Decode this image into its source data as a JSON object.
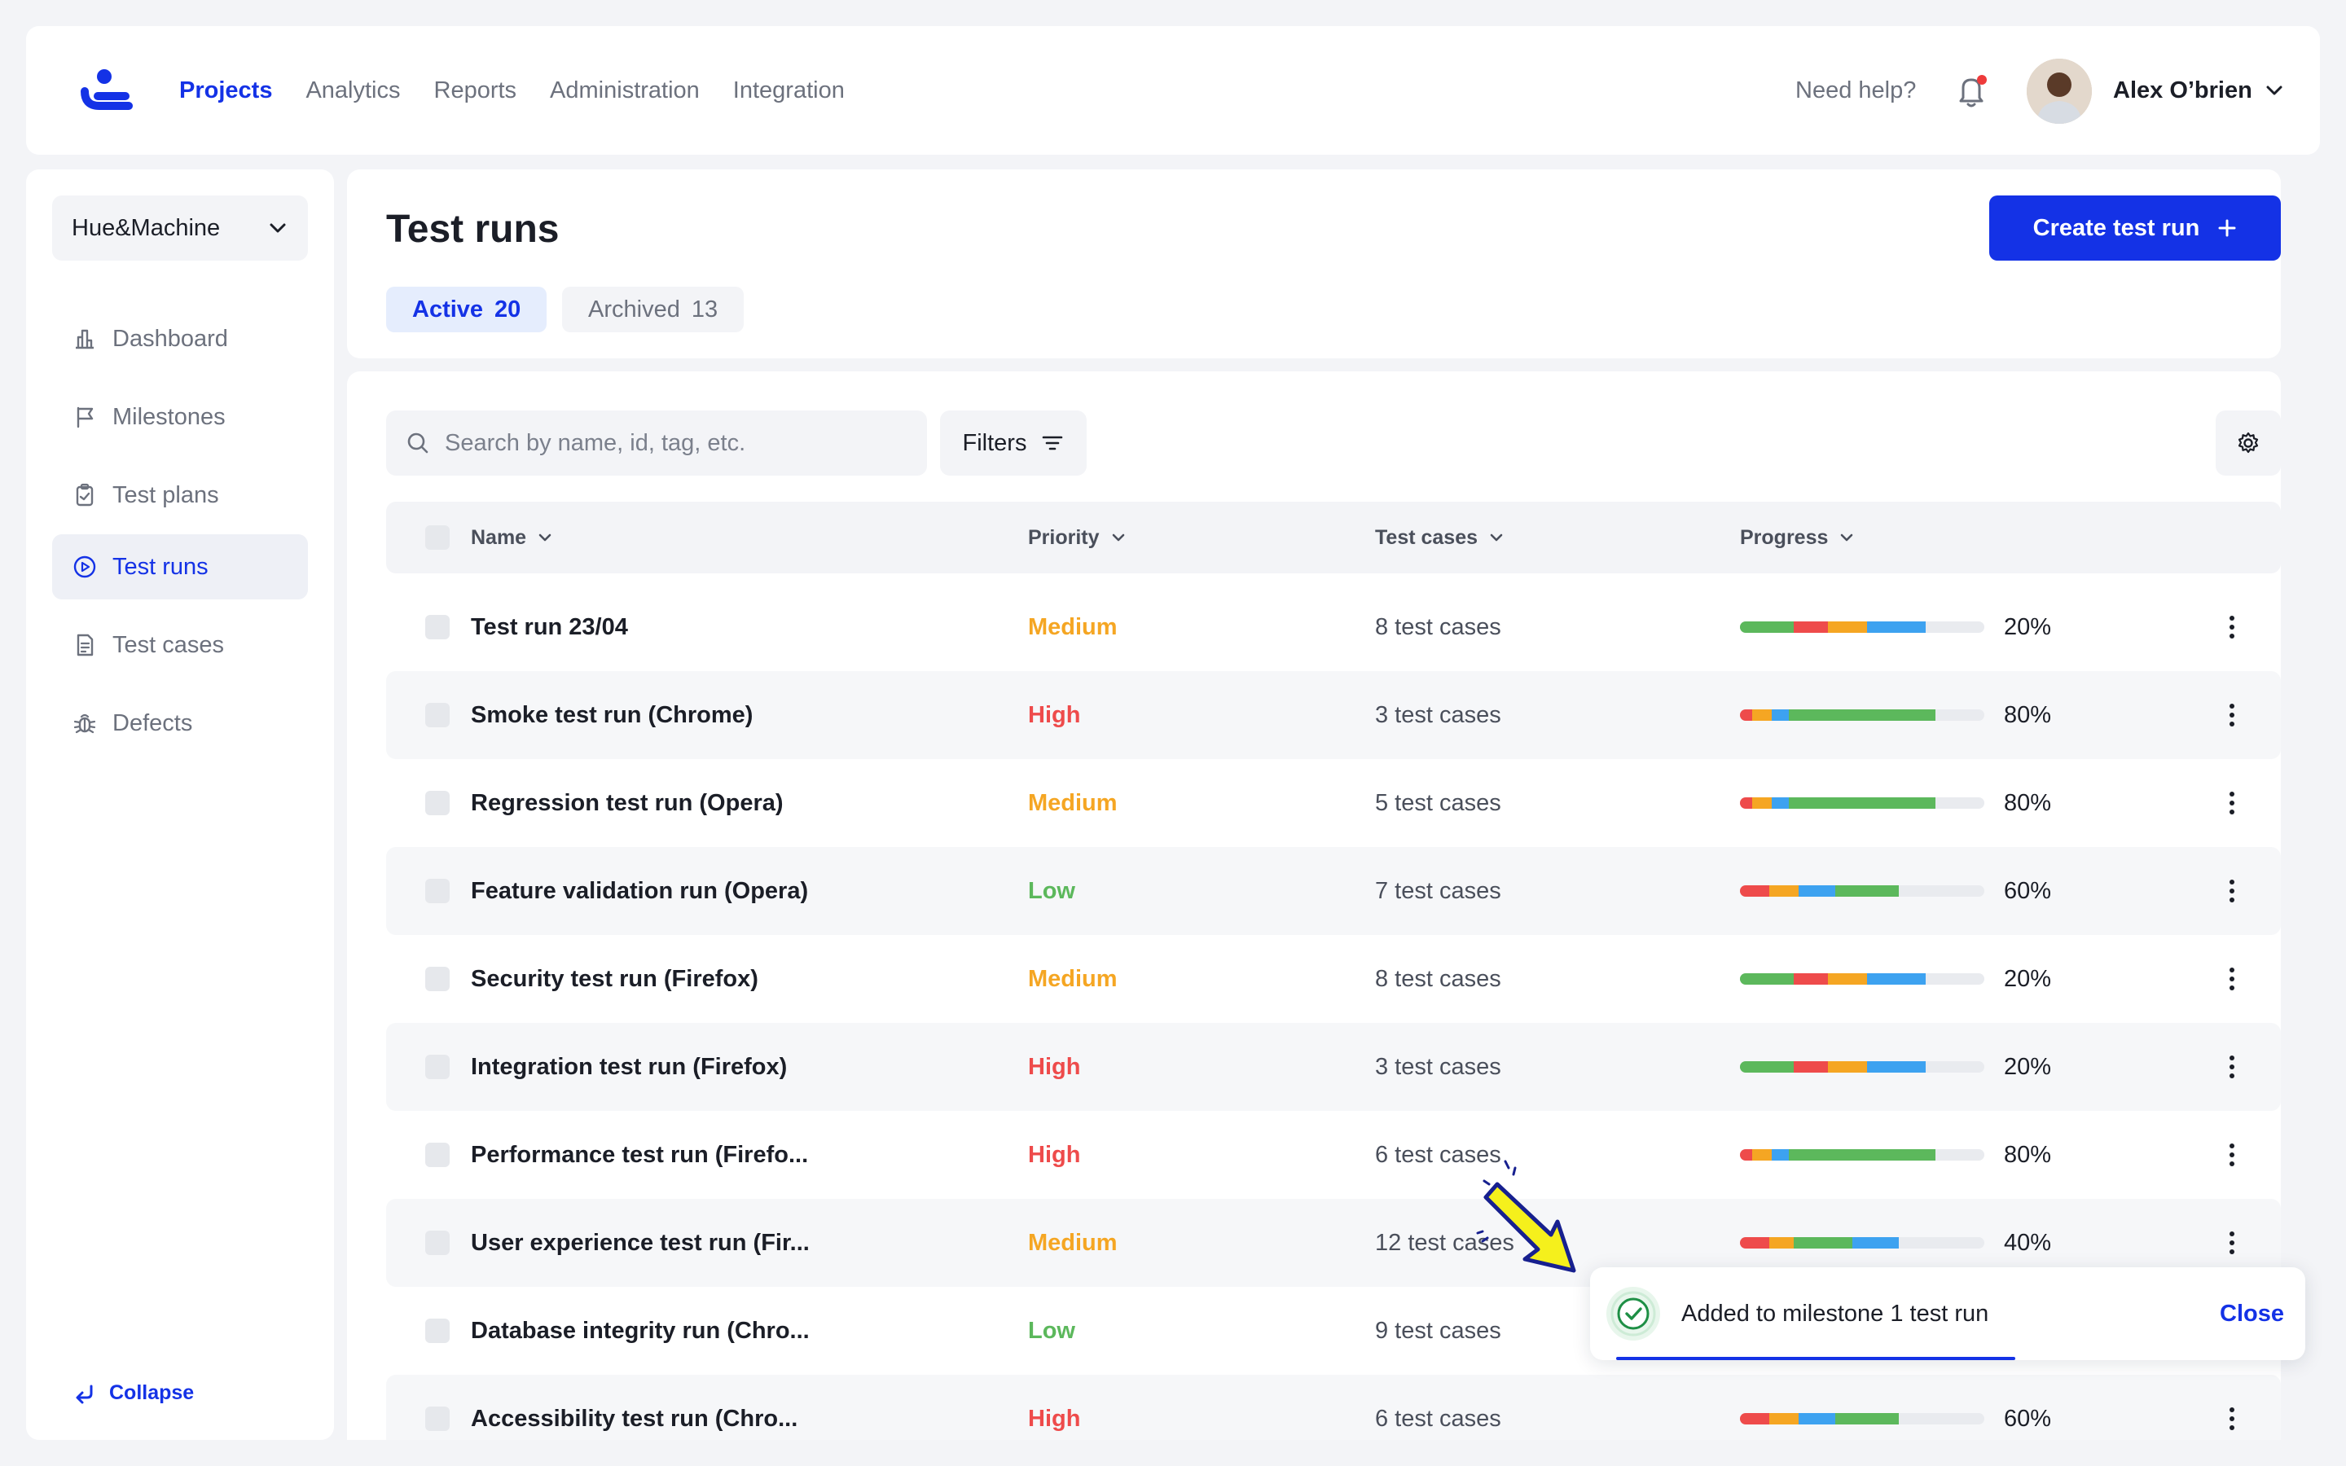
{
  "nav": {
    "links": [
      "Projects",
      "Analytics",
      "Reports",
      "Administration",
      "Integration"
    ],
    "help": "Need help?",
    "user": "Alex O’brien"
  },
  "sidebar": {
    "project": "Hue&Machine",
    "items": [
      {
        "label": "Dashboard",
        "icon": "dashboard-icon"
      },
      {
        "label": "Milestones",
        "icon": "flag-icon"
      },
      {
        "label": "Test plans",
        "icon": "clipboard-icon"
      },
      {
        "label": "Test runs",
        "icon": "play-circle-icon"
      },
      {
        "label": "Test cases",
        "icon": "document-icon"
      },
      {
        "label": "Defects",
        "icon": "bug-icon"
      }
    ],
    "collapse": "Collapse"
  },
  "header": {
    "title": "Test runs",
    "create_label": "Create test run",
    "tabs": [
      {
        "label": "Active",
        "count": "20"
      },
      {
        "label": "Archived",
        "count": "13"
      }
    ]
  },
  "toolbar": {
    "search_placeholder": "Search by name, id, tag, etc.",
    "filters_label": "Filters"
  },
  "table": {
    "columns": [
      "Name",
      "Priority",
      "Test cases",
      "Progress"
    ],
    "rows": [
      {
        "name": "Test run 23/04",
        "priority": "Medium",
        "cases": "8 test cases",
        "progress": "20%",
        "segments": [
          [
            "#5CB85C",
            22
          ],
          [
            "#EE4B4B",
            14
          ],
          [
            "#F5A623",
            16
          ],
          [
            "#3DA2F0",
            24
          ]
        ]
      },
      {
        "name": "Smoke test run (Chrome)",
        "priority": "High",
        "cases": "3 test cases",
        "progress": "80%",
        "segments": [
          [
            "#EE4B4B",
            5
          ],
          [
            "#F5A623",
            8
          ],
          [
            "#3DA2F0",
            7
          ],
          [
            "#5CB85C",
            60
          ]
        ]
      },
      {
        "name": "Regression test run (Opera)",
        "priority": "Medium",
        "cases": "5 test cases",
        "progress": "80%",
        "segments": [
          [
            "#EE4B4B",
            5
          ],
          [
            "#F5A623",
            8
          ],
          [
            "#3DA2F0",
            7
          ],
          [
            "#5CB85C",
            60
          ]
        ]
      },
      {
        "name": "Feature validation run (Opera)",
        "priority": "Low",
        "cases": "7 test cases",
        "progress": "60%",
        "segments": [
          [
            "#EE4B4B",
            12
          ],
          [
            "#F5A623",
            12
          ],
          [
            "#3DA2F0",
            15
          ],
          [
            "#5CB85C",
            26
          ]
        ]
      },
      {
        "name": "Security test run (Firefox)",
        "priority": "Medium",
        "cases": "8 test cases",
        "progress": "20%",
        "segments": [
          [
            "#5CB85C",
            22
          ],
          [
            "#EE4B4B",
            14
          ],
          [
            "#F5A623",
            16
          ],
          [
            "#3DA2F0",
            24
          ]
        ]
      },
      {
        "name": "Integration test run (Firefox)",
        "priority": "High",
        "cases": "3 test cases",
        "progress": "20%",
        "segments": [
          [
            "#5CB85C",
            22
          ],
          [
            "#EE4B4B",
            14
          ],
          [
            "#F5A623",
            16
          ],
          [
            "#3DA2F0",
            24
          ]
        ]
      },
      {
        "name": "Performance test run (Firefo...",
        "priority": "High",
        "cases": "6 test cases",
        "progress": "80%",
        "segments": [
          [
            "#EE4B4B",
            5
          ],
          [
            "#F5A623",
            8
          ],
          [
            "#3DA2F0",
            7
          ],
          [
            "#5CB85C",
            60
          ]
        ]
      },
      {
        "name": "User experience test run (Fir...",
        "priority": "Medium",
        "cases": "12 test cases",
        "progress": "40%",
        "segments": [
          [
            "#EE4B4B",
            12
          ],
          [
            "#F5A623",
            10
          ],
          [
            "#5CB85C",
            24
          ],
          [
            "#3DA2F0",
            19
          ]
        ]
      },
      {
        "name": "Database integrity run (Chro...",
        "priority": "Low",
        "cases": "9 test cases",
        "progress": "",
        "segments": []
      },
      {
        "name": "Accessibility test run (Chro...",
        "priority": "High",
        "cases": "6 test cases",
        "progress": "60%",
        "segments": [
          [
            "#EE4B4B",
            12
          ],
          [
            "#F5A623",
            12
          ],
          [
            "#3DA2F0",
            15
          ],
          [
            "#5CB85C",
            26
          ]
        ]
      }
    ]
  },
  "priority_colors": {
    "High": "#EE4B4B",
    "Medium": "#F5A623",
    "Low": "#5CB85C"
  },
  "toast": {
    "message": "Added to milestone 1 test run",
    "close": "Close"
  },
  "colors": {
    "accent": "#1432E6",
    "background": "#F3F4F7"
  }
}
